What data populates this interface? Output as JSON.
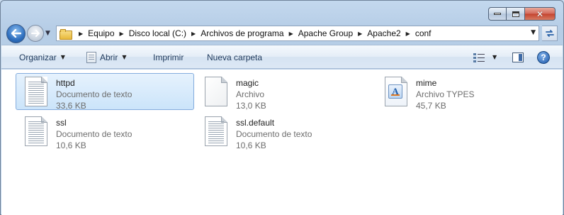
{
  "window": {
    "controls": {
      "minimize": "minimize",
      "maximize": "maximize",
      "close": "✕"
    }
  },
  "address_bar": {
    "crumbs": [
      "Equipo",
      "Disco local (C:)",
      "Archivos de programa",
      "Apache Group",
      "Apache2",
      "conf"
    ]
  },
  "toolbar": {
    "organize_label": "Organizar",
    "open_label": "Abrir",
    "print_label": "Imprimir",
    "new_folder_label": "Nueva carpeta"
  },
  "files": [
    {
      "name": "httpd",
      "type": "Documento de texto",
      "size": "33,6 KB",
      "icon": "text-file-icon",
      "selected": true
    },
    {
      "name": "magic",
      "type": "Archivo",
      "size": "13,0 KB",
      "icon": "blank-file-icon",
      "selected": false
    },
    {
      "name": "mime",
      "type": "Archivo TYPES",
      "size": "45,7 KB",
      "icon": "types-file-icon",
      "selected": false
    },
    {
      "name": "ssl",
      "type": "Documento de texto",
      "size": "10,6 KB",
      "icon": "text-file-icon",
      "selected": false
    },
    {
      "name": "ssl.default",
      "type": "Documento de texto",
      "size": "10,6 KB",
      "icon": "text-file-icon",
      "selected": false
    }
  ],
  "colors": {
    "accent": "#1e395b",
    "selection": "#cbe4fa",
    "selection_border": "#84acdd"
  }
}
